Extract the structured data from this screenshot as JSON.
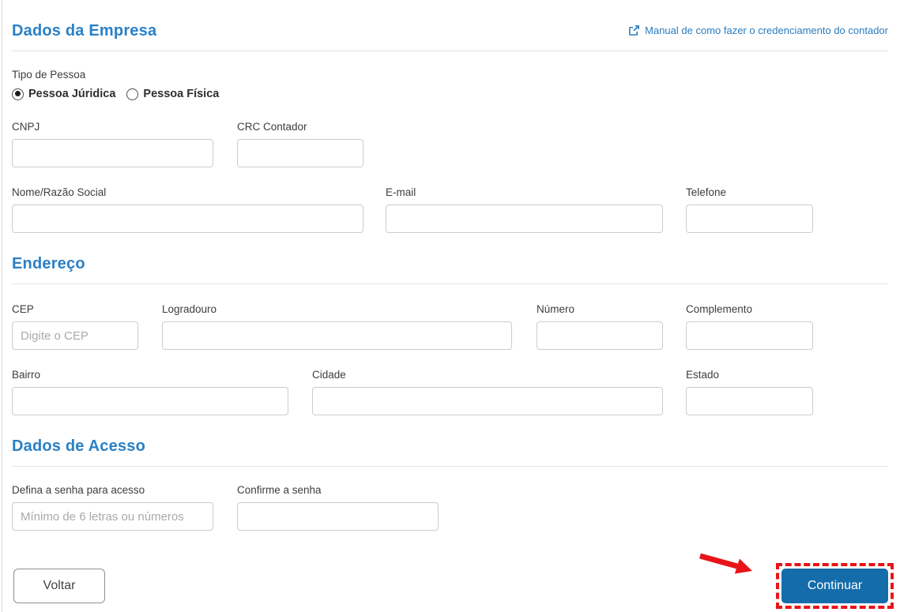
{
  "header": {
    "title": "Dados da Empresa",
    "manual_link": {
      "label": "Manual de como fazer o credenciamento do contador",
      "icon": "external-link-icon"
    }
  },
  "tipo_pessoa": {
    "label": "Tipo de Pessoa",
    "options": [
      {
        "label": "Pessoa Júridica",
        "selected": true
      },
      {
        "label": "Pessoa Física",
        "selected": false
      }
    ]
  },
  "empresa": {
    "fields": {
      "cnpj": {
        "label": "CNPJ",
        "value": "",
        "placeholder": ""
      },
      "crc_contador": {
        "label": "CRC Contador",
        "value": "",
        "placeholder": ""
      },
      "nome_razao_social": {
        "label": "Nome/Razão Social",
        "value": "",
        "placeholder": ""
      },
      "email": {
        "label": "E-mail",
        "value": "",
        "placeholder": ""
      },
      "telefone": {
        "label": "Telefone",
        "value": "",
        "placeholder": ""
      }
    }
  },
  "endereco": {
    "title": "Endereço",
    "fields": {
      "cep": {
        "label": "CEP",
        "value": "",
        "placeholder": "Digite o CEP"
      },
      "logradouro": {
        "label": "Logradouro",
        "value": "",
        "placeholder": ""
      },
      "numero": {
        "label": "Número",
        "value": "",
        "placeholder": ""
      },
      "complemento": {
        "label": "Complemento",
        "value": "",
        "placeholder": ""
      },
      "bairro": {
        "label": "Bairro",
        "value": "",
        "placeholder": ""
      },
      "cidade": {
        "label": "Cidade",
        "value": "",
        "placeholder": ""
      },
      "estado": {
        "label": "Estado",
        "value": "",
        "placeholder": ""
      }
    }
  },
  "acesso": {
    "title": "Dados de Acesso",
    "fields": {
      "senha": {
        "label": "Defina a senha para acesso",
        "value": "",
        "placeholder": "Mínimo de 6 letras ou números"
      },
      "confirmar_senha": {
        "label": "Confirme a senha",
        "value": "",
        "placeholder": ""
      }
    }
  },
  "actions": {
    "voltar": {
      "label": "Voltar"
    },
    "continuar": {
      "label": "Continuar"
    }
  },
  "colors": {
    "section_title_blue": "#2a80c5",
    "link_blue": "#2a7cbf",
    "continuar_button_blue": "#146cab",
    "annotation_red": "#e81417"
  }
}
